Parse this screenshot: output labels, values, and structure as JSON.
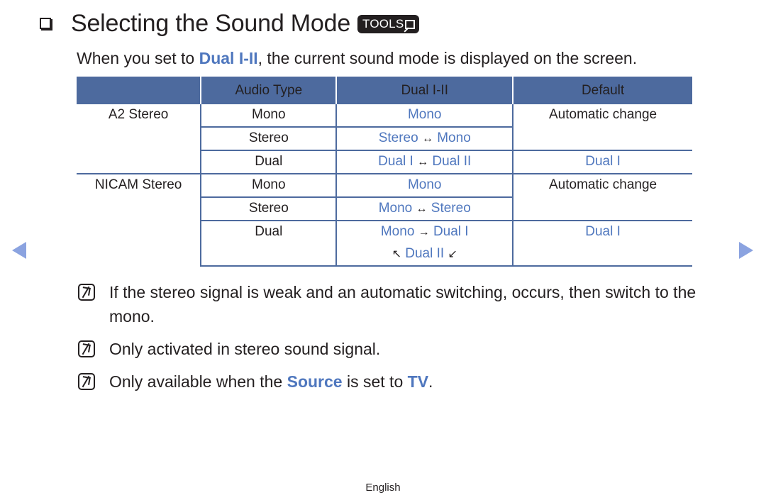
{
  "header": {
    "title": "Selecting the Sound Mode",
    "tools_badge": "TOOLS",
    "icon": "checkbox-square-icon"
  },
  "intro": {
    "before": "When you set to ",
    "highlight": "Dual I-II",
    "after": ", the current sound mode is displayed on the screen."
  },
  "table": {
    "headers": [
      "",
      "Audio Type",
      "Dual I-II",
      "Default"
    ],
    "groups": [
      {
        "name": "A2 Stereo",
        "rows": [
          {
            "audio_type": "Mono",
            "dual": "Mono",
            "default": "Automatic change"
          },
          {
            "audio_type": "Stereo",
            "dual_a": "Stereo",
            "dual_sym": "↔",
            "dual_b": "Mono"
          },
          {
            "audio_type": "Dual",
            "dual_a": "Dual I",
            "dual_sym": "↔",
            "dual_b": "Dual II",
            "default": "Dual I"
          }
        ]
      },
      {
        "name": "NICAM Stereo",
        "rows": [
          {
            "audio_type": "Mono",
            "dual": "Mono",
            "default": "Automatic change"
          },
          {
            "audio_type": "Stereo",
            "dual_a": "Mono",
            "dual_sym": "↔",
            "dual_b": "Stereo"
          },
          {
            "audio_type": "Dual",
            "dual_a": "Mono",
            "dual_sym": "→",
            "dual_b": "Dual I",
            "line2_pre": "↖",
            "line2_mid": "Dual II",
            "line2_post": "↙",
            "default": "Dual I"
          }
        ]
      }
    ]
  },
  "notes": [
    {
      "icon": "note-icon",
      "text": "If the stereo signal is weak and an automatic switching, occurs, then switch to the mono."
    },
    {
      "icon": "note-icon",
      "text": "Only activated in stereo sound signal."
    },
    {
      "icon": "note-icon",
      "before": "Only available when the ",
      "hl1": "Source",
      "mid": " is set to ",
      "hl2": "TV",
      "after": "."
    }
  ],
  "navigation": {
    "prev": "previous-page",
    "next": "next-page"
  },
  "footer": {
    "language": "English"
  }
}
